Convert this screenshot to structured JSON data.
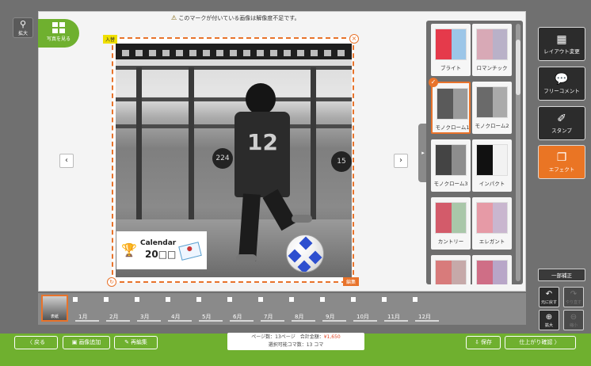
{
  "zoom": {
    "label": "拡大"
  },
  "canvas": {
    "warning": "このマークが付いている画像は解像度不足です。",
    "photo_button": "写真を見る",
    "page_tag": "入替",
    "edit_tag": "編集",
    "calendar_title": "Calendar",
    "calendar_year": "20□□",
    "sign_left": "224",
    "sign_right": "15",
    "jersey_number": "12"
  },
  "effects": {
    "items": [
      {
        "label": "ブライト",
        "c1": "#e53a4b",
        "c2": "#9cc6e8"
      },
      {
        "label": "ロマンチック",
        "c1": "#d8a9b6",
        "c2": "#b9b1c8"
      },
      {
        "label": "モノクローム1",
        "c1": "#5a5a5a",
        "c2": "#9a9a9a",
        "selected": true
      },
      {
        "label": "モノクローム2",
        "c1": "#6a6a6a",
        "c2": "#aaaaaa"
      },
      {
        "label": "モノクローム3",
        "c1": "#444444",
        "c2": "#8d8d8d"
      },
      {
        "label": "インパクト",
        "c1": "#111111",
        "c2": "#f2f2f2"
      },
      {
        "label": "カントリー",
        "c1": "#d35b6a",
        "c2": "#a9c7a9"
      },
      {
        "label": "エレガント",
        "c1": "#e69aa6",
        "c2": "#c9b6cf"
      },
      {
        "label": "",
        "c1": "#d87b7b",
        "c2": "#c6a9a9"
      },
      {
        "label": "",
        "c1": "#cf6e86",
        "c2": "#b8a6c8"
      }
    ]
  },
  "tools": {
    "layout": "レイアウト変更",
    "free_comment": "フリーコメント",
    "stamp": "スタンプ",
    "effect": "エフェクト",
    "partial": "一部補正",
    "undo": "元に戻す",
    "redo": "やり直す",
    "zoom_in": "拡大",
    "zoom_out": "縮小"
  },
  "filmstrip": {
    "cover": "表紙",
    "months": [
      "1月",
      "2月",
      "3月",
      "4月",
      "5月",
      "6月",
      "7月",
      "8月",
      "9月",
      "10月",
      "11月",
      "12月"
    ]
  },
  "bottom": {
    "back": "戻る",
    "add_image": "画像追加",
    "re_edit": "再編集",
    "status_line1_a": "ページ数：13ページ　合計金額：",
    "price": "¥1,650",
    "status_line2": "選択可能コマ数：13 コマ",
    "save": "保存",
    "confirm": "仕上がり確認"
  }
}
